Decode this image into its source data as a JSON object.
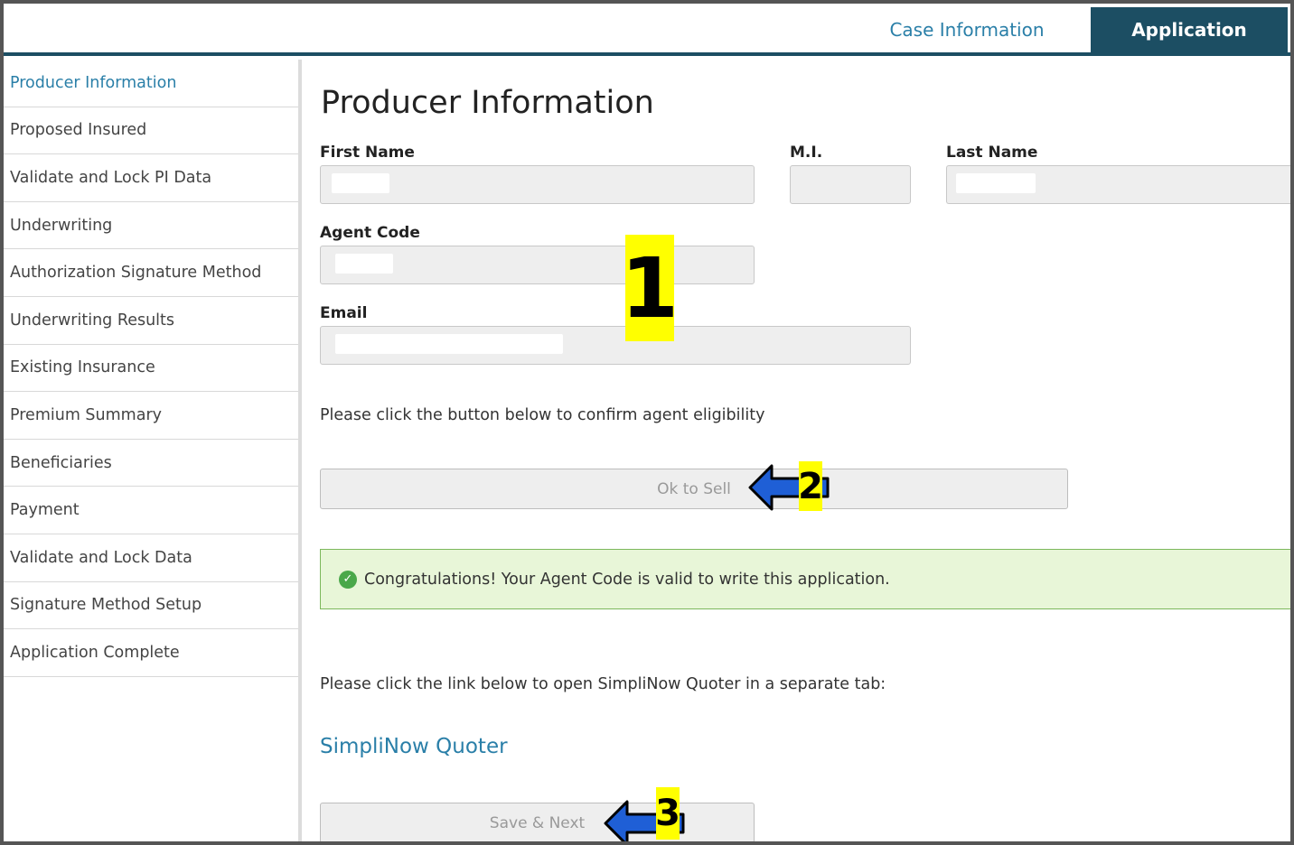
{
  "tabs": {
    "case_information": "Case Information",
    "application": "Application"
  },
  "sidebar": {
    "items": [
      {
        "label": "Producer Information"
      },
      {
        "label": "Proposed Insured"
      },
      {
        "label": "Validate and Lock PI Data"
      },
      {
        "label": "Underwriting"
      },
      {
        "label": "Authorization Signature Method"
      },
      {
        "label": "Underwriting Results"
      },
      {
        "label": "Existing Insurance"
      },
      {
        "label": "Premium Summary"
      },
      {
        "label": "Beneficiaries"
      },
      {
        "label": "Payment"
      },
      {
        "label": "Validate and Lock Data"
      },
      {
        "label": "Signature Method Setup"
      },
      {
        "label": "Application Complete"
      }
    ]
  },
  "main": {
    "title": "Producer Information",
    "first_name_label": "First Name",
    "mi_label": "M.I.",
    "last_name_label": "Last Name",
    "agent_code_label": "Agent Code",
    "email_label": "Email",
    "eligibility_text": "Please click the button below to confirm agent eligibility",
    "ok_to_sell_label": "Ok to Sell",
    "success_message": "Congratulations! Your Agent Code is valid to write this application.",
    "quoter_text": "Please click the link below to open SimpliNow Quoter in a separate tab:",
    "quoter_link": "SimpliNow Quoter",
    "save_next_label": "Save & Next"
  },
  "annotations": {
    "step1": "1",
    "step2": "2",
    "step3": "3"
  },
  "colors": {
    "accent": "#2a7fa8",
    "header_dark": "#1c4e63",
    "success_bg": "#e8f6d8",
    "success_border": "#7cb85c",
    "annotation_yellow": "#ffff00",
    "arrow_blue": "#1f5fd6"
  }
}
